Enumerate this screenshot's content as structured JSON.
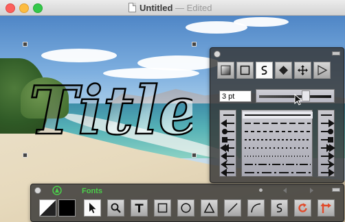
{
  "window": {
    "title": "Untitled",
    "separator": "—",
    "status": "Edited"
  },
  "canvas": {
    "text_art": "Title"
  },
  "inspector": {
    "tools": [
      {
        "name": "gradient-fill-tool",
        "icon": "gradient-square-icon"
      },
      {
        "name": "rectangle-style-tool",
        "icon": "square-icon"
      },
      {
        "name": "freehand-stroke-tool",
        "icon": "s-curve-icon"
      },
      {
        "name": "diamond-tool",
        "icon": "diamond-icon"
      },
      {
        "name": "move-tool",
        "icon": "four-arrows-icon"
      },
      {
        "name": "play-tool",
        "icon": "play-triangle-icon"
      }
    ],
    "stroke_width": "3 pt",
    "stroke_slider_value": 0.65
  },
  "toolbar": {
    "fonts_label": "Fonts",
    "tools": [
      {
        "name": "select-tool",
        "icon": "arrow-cursor-icon",
        "selected": true
      },
      {
        "name": "zoom-tool",
        "icon": "magnifier-icon"
      },
      {
        "name": "text-tool",
        "icon": "T-icon"
      },
      {
        "name": "rectangle-tool",
        "icon": "square-icon"
      },
      {
        "name": "ellipse-tool",
        "icon": "circle-icon"
      },
      {
        "name": "triangle-tool",
        "icon": "triangle-icon"
      },
      {
        "name": "line-tool",
        "icon": "line-icon"
      },
      {
        "name": "arc-tool",
        "icon": "arc-icon"
      },
      {
        "name": "freehand-tool",
        "icon": "s-curve-icon"
      },
      {
        "name": "rotate-tool",
        "icon": "rotate-icon"
      },
      {
        "name": "connector-tool",
        "icon": "arrows-icon"
      }
    ]
  },
  "colors": {
    "accent_green": "#4bd04b",
    "rotate_red": "#e04a2a"
  }
}
